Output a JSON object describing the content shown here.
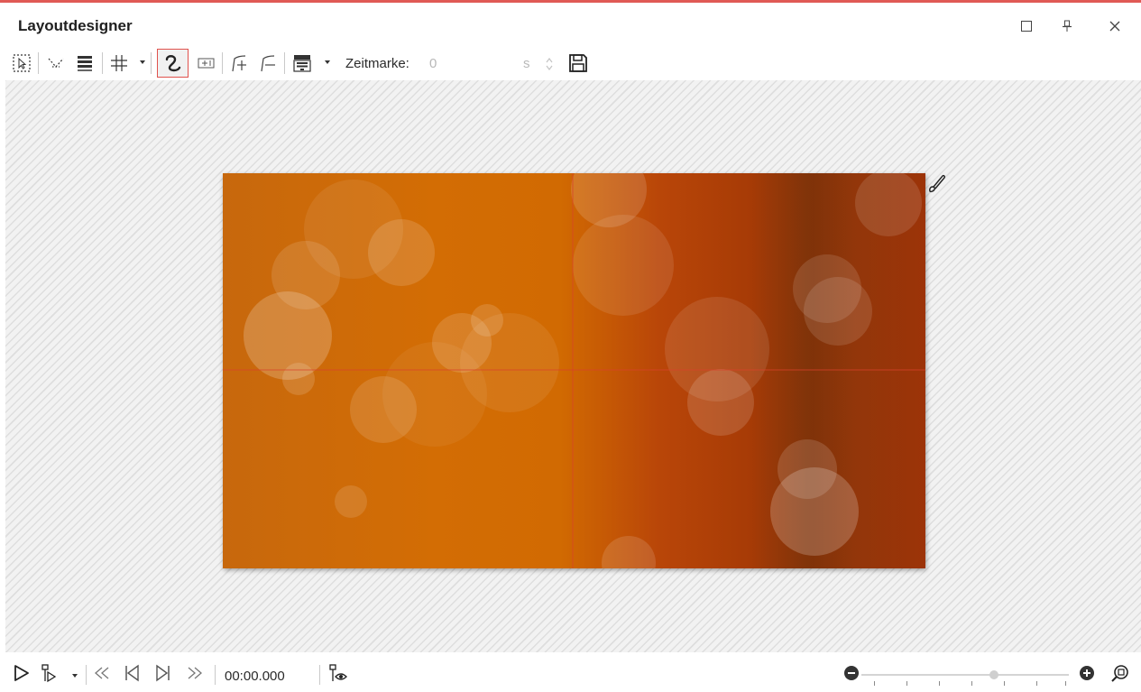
{
  "app": {
    "title": "Layoutdesigner"
  },
  "window_controls": {
    "maximize_icon": "square-icon",
    "pin_icon": "pin-icon",
    "close_icon": "x-icon"
  },
  "toolbar": {
    "tools": [
      {
        "name": "selection-tool",
        "icon": "dotted-select-icon"
      },
      {
        "name": "animation-path-tool",
        "icon": "dotted-chevron-icon"
      },
      {
        "name": "align-layers-tool",
        "icon": "stacked-bars-icon"
      },
      {
        "name": "grid-tool",
        "icon": "grid-icon",
        "has_dropdown": true
      },
      {
        "name": "curve-path-tool",
        "icon": "curve-icon",
        "active": true
      },
      {
        "name": "camera-tool",
        "icon": "frame-plus-icon"
      },
      {
        "name": "add-keyframe-tool",
        "icon": "path-plus-icon"
      },
      {
        "name": "remove-keyframe-tool",
        "icon": "path-minus-icon"
      },
      {
        "name": "template-tool",
        "icon": "layout-template-icon",
        "has_dropdown": true
      },
      {
        "name": "save-tool",
        "icon": "floppy-icon"
      }
    ],
    "zeitmarke": {
      "label": "Zeitmarke:",
      "value": "0",
      "unit": "s"
    }
  },
  "colors": {
    "accent": "#e05a55",
    "slide_left": "#c7680d",
    "slide_mid": "#d36d04",
    "slide_right": "#9c3308",
    "guide": "#d8412b"
  },
  "playback": {
    "play_icon": "play-icon",
    "play_from_marker_icon": "play-from-marker-icon",
    "rewind_icon": "double-left-icon",
    "prev_frame_icon": "step-back-icon",
    "next_frame_icon": "step-forward-icon",
    "forward_icon": "double-right-icon",
    "time": "00:00.000",
    "preview_icon": "marker-eye-icon"
  },
  "zoom": {
    "minus_icon": "zoom-out-icon",
    "plus_icon": "zoom-in-icon",
    "fit_icon": "magnifier-icon",
    "level": 0.64
  }
}
